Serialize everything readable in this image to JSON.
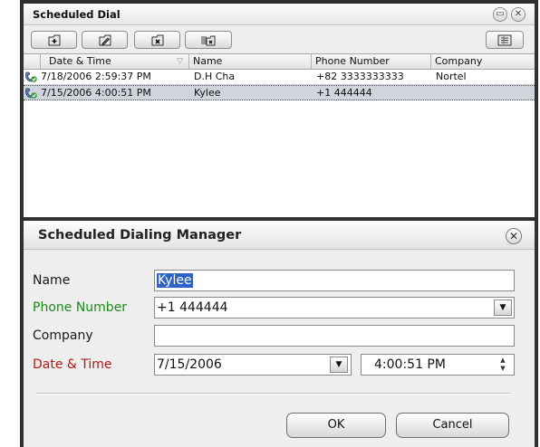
{
  "scheduled_dial": {
    "title": "Scheduled Dial",
    "toolbar": {
      "add": "add-schedule-icon",
      "edit": "edit-schedule-icon",
      "delete": "delete-schedule-icon",
      "delete_all": "delete-all-schedules-icon",
      "view": "list-view-icon"
    },
    "columns": [
      "Date & Time",
      "Name",
      "Phone Number",
      "Company"
    ],
    "sort_indicator": "▽",
    "rows": [
      {
        "date_time": "7/18/2006 2:59:37 PM",
        "name": "D.H Cha",
        "phone": "+82 3333333333",
        "company": "Nortel",
        "icon": "scheduled-call-icon",
        "selected": false
      },
      {
        "date_time": "7/15/2006 4:00:51 PM",
        "name": "Kylee",
        "phone": "+1 444444",
        "company": "",
        "icon": "scheduled-call-icon",
        "selected": true
      }
    ]
  },
  "dialog": {
    "title": "Scheduled Dialing Manager",
    "labels": {
      "name": "Name",
      "phone": "Phone Number",
      "company": "Company",
      "date_time": "Date & Time"
    },
    "values": {
      "name": "Kylee",
      "phone": "+1 444444",
      "company": "",
      "date": "7/15/2006",
      "time": "4:00:51 PM"
    },
    "buttons": {
      "ok": "OK",
      "cancel": "Cancel"
    }
  },
  "colors": {
    "required_label": "#1a8a1a",
    "error_label": "#b01a1a",
    "selection": "#2e62c6",
    "selected_row": "#d0d4dc"
  }
}
